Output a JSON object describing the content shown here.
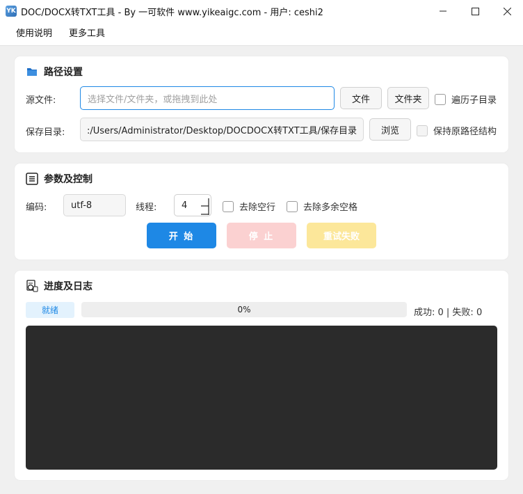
{
  "window": {
    "app_icon_text": "YK",
    "title": "DOC/DOCX转TXT工具 - By 一可软件 www.yikeaigc.com - 用户: ceshi2"
  },
  "menu": {
    "items": [
      "使用说明",
      "更多工具"
    ]
  },
  "path_section": {
    "title": "路径设置",
    "source_label": "源文件:",
    "source_value": "",
    "source_placeholder": "选择文件/文件夹，或拖拽到此处",
    "file_button": "文件",
    "folder_button": "文件夹",
    "recursive_label": "遍历子目录",
    "save_label": "保存目录:",
    "save_value": ":/Users/Administrator/Desktop/DOCDOCX转TXT工具/保存目录",
    "browse_button": "浏览",
    "keep_structure_label": "保持原路径结构"
  },
  "params_section": {
    "title": "参数及控制",
    "encoding_label": "编码:",
    "encoding_value": "utf-8",
    "threads_label": "线程:",
    "threads_value": "4",
    "remove_blank_lines_label": "去除空行",
    "remove_extra_spaces_label": "去除多余空格",
    "start_button": "开 始",
    "stop_button": "停 止",
    "retry_button": "重试失败"
  },
  "progress_section": {
    "title": "进度及日志",
    "status": "就绪",
    "progress_text": "0%",
    "progress_fraction": 0,
    "summary": "成功: 0 | 失败: 0"
  },
  "colors": {
    "accent": "#1e88e5",
    "start": "#1e88e5",
    "stop_disabled": "#fbd1d1",
    "retry_disabled": "#fce79a",
    "log_bg": "#2b2b2b"
  },
  "icons": {
    "app": "app-logo-icon",
    "minimize": "minimize-icon",
    "maximize": "maximize-icon",
    "close": "close-icon",
    "path": "folder-icon",
    "params": "list-icon",
    "progress": "log-search-icon"
  }
}
